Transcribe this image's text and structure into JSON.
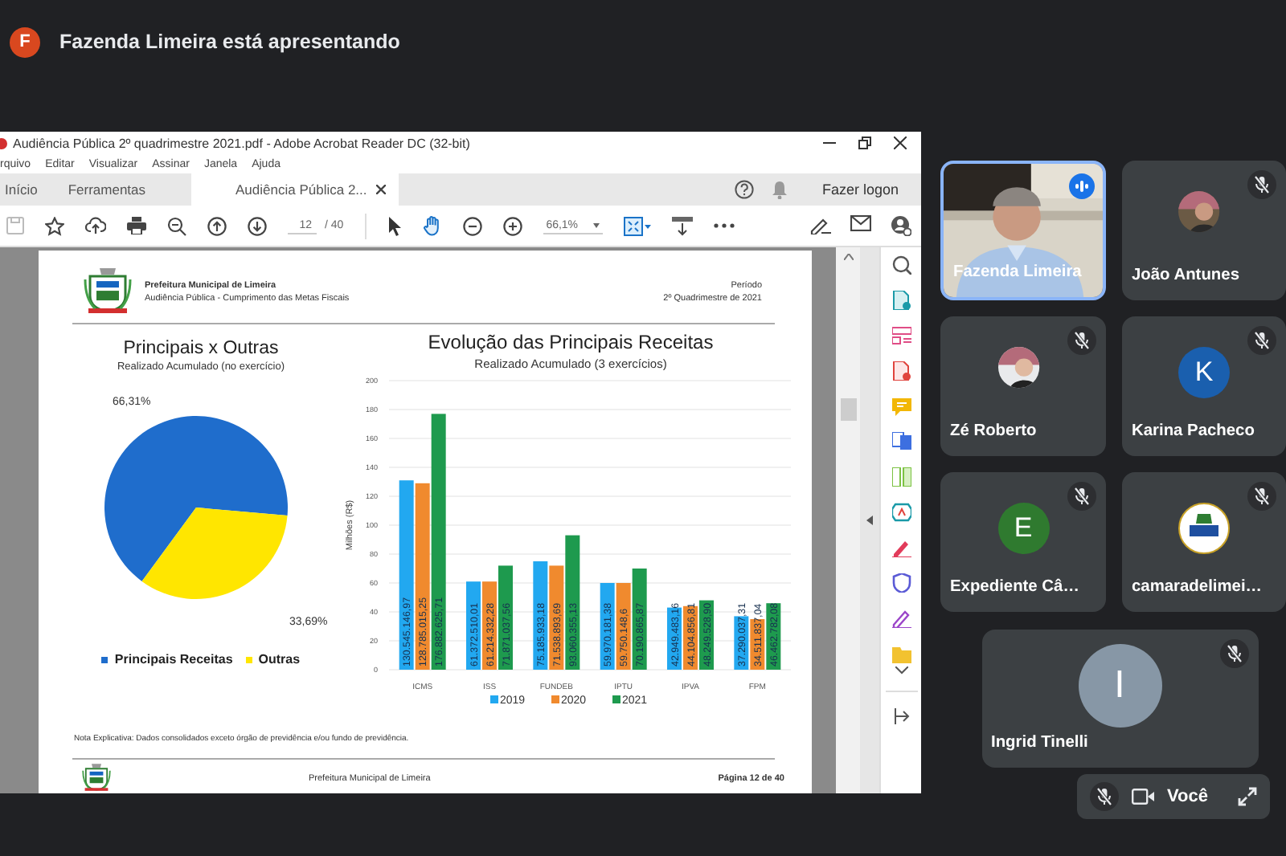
{
  "presenter_bar": {
    "avatar_letter": "F",
    "text": "Fazenda Limeira está apresentando"
  },
  "acrobat": {
    "title": "Audiência Pública 2º quadrimestre 2021.pdf - Adobe Acrobat Reader DC (32-bit)",
    "menu": [
      "rquivo",
      "Editar",
      "Visualizar",
      "Assinar",
      "Janela",
      "Ajuda"
    ],
    "tabs": [
      {
        "label": "Início",
        "selected": false
      },
      {
        "label": "Ferramentas",
        "selected": false
      },
      {
        "label": "Audiência Pública 2...",
        "selected": true
      }
    ],
    "sign_in": "Fazer logon",
    "page_number": "12",
    "page_total": "/ 40",
    "zoom": "66,1%"
  },
  "document": {
    "org": "Prefeitura Municipal de Limeira",
    "subtitle": "Audiência Pública - Cumprimento das Metas Fiscais",
    "period_label": "Período",
    "period": "2º Quadrimestre de 2021",
    "pie": {
      "chart_data": {
        "type": "pie",
        "title": "Principais x Outras",
        "categories": [
          "Principais Receitas",
          "Outras"
        ],
        "series": [
          {
            "name": "Realizado Acumulado (no exercício)",
            "values": [
              66.31,
              33.69
            ]
          }
        ],
        "value_labels": [
          "66,31%",
          "33,69%"
        ],
        "legend": "bottom"
      },
      "slice_colors": [
        {
          "color": "#1f6dcc"
        },
        {
          "color": "#ffe600"
        }
      ]
    },
    "bars": {
      "subtitle": "Realizado Acumulado (3 exercícios)",
      "chart_data": {
        "type": "bar",
        "title": "Evolução das Principais Receitas",
        "ylabel": "Milhões (R$)",
        "categories": [
          "ICMS",
          "ISS",
          "FUNDEB",
          "IPTU",
          "IPVA",
          "FPM"
        ],
        "series": [
          {
            "name": "2019",
            "color": "#22a8f0",
            "values": [
              131,
              61,
              75,
              60,
              43,
              37
            ]
          },
          {
            "name": "2020",
            "color": "#f08a2e",
            "values": [
              129,
              61,
              72,
              60,
              44,
              35
            ]
          },
          {
            "name": "2021",
            "color": "#1e9a4e",
            "values": [
              177,
              72,
              93,
              70,
              48,
              46
            ]
          }
        ],
        "ylim": [
          0,
          200
        ],
        "yticks": [
          0,
          20,
          40,
          60,
          80,
          100,
          120,
          140,
          160,
          180,
          200
        ],
        "grid": true,
        "legend": "bottom",
        "value_labels": [
          [
            "130.545.146,97",
            "61.372.510,01",
            "75.185.933,18",
            "59.970.181,38",
            "42.949.483,16",
            "37.290.037,31"
          ],
          [
            "128.785.015,25",
            "61.214.332,28",
            "71.538.893,69",
            "59.750.148,6",
            "44.104.856,81",
            "34.511.837,04"
          ],
          [
            "176.882.625,71",
            "71.871.037,56",
            "93.060.355,13",
            "70.190.865,87",
            "48.249.528,90",
            "46.462.782,08"
          ]
        ]
      }
    },
    "note": "Nota Explicativa: Dados consolidados exceto órgão de previdência e/ou fundo de previdência.",
    "footer": "Prefeitura Municipal de Limeira",
    "page_label": "Página 12 de 40"
  },
  "participants": [
    {
      "name": "Fazenda Limeira",
      "kind": "video",
      "speaking": true,
      "muted": false
    },
    {
      "name": "João Antunes",
      "speaking": false,
      "muted": true
    },
    {
      "name": "Zé Roberto",
      "speaking": false,
      "muted": true
    },
    {
      "name": "Karina Pacheco",
      "kind": "letter",
      "letter": "K",
      "color": "#1a5fae",
      "speaking": false,
      "muted": true
    },
    {
      "name": "Expediente Câ…",
      "kind": "letter",
      "letter": "E",
      "color": "#2f7a2f",
      "speaking": false,
      "muted": true
    },
    {
      "name": "camaradelimei…",
      "kind": "logo",
      "speaking": false,
      "muted": true
    },
    {
      "name": "Ingrid Tinelli",
      "kind": "letter",
      "letter": "I",
      "color": "#8797a6",
      "speaking": false,
      "muted": true
    }
  ],
  "self_view": {
    "label": "Você",
    "mic_muted": true
  }
}
